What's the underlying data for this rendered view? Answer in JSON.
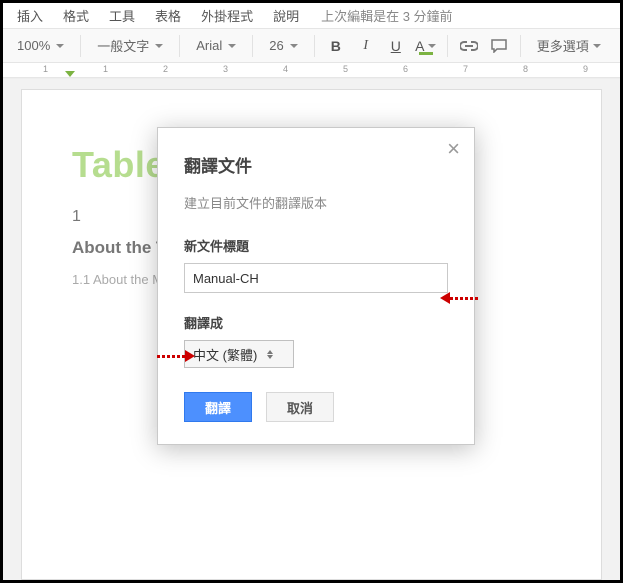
{
  "menubar": {
    "items": [
      "插入",
      "格式",
      "工具",
      "表格",
      "外掛程式",
      "說明"
    ],
    "last_edit": "上次編輯是在 3 分鐘前"
  },
  "toolbar": {
    "zoom": "100%",
    "style": "一般文字",
    "font": "Arial",
    "size": "26",
    "bold": "B",
    "italic": "I",
    "underline": "U",
    "textcolor": "A",
    "more": "更多選項"
  },
  "ruler": {
    "marks": [
      "1",
      "1",
      "2",
      "3",
      "4",
      "5",
      "6",
      "7",
      "8",
      "9"
    ]
  },
  "document": {
    "heading": "Table of content",
    "num": "1",
    "h1": "About the TeamViewer Management Console 4",
    "sub": "1.1 About the Management Console 4"
  },
  "dialog": {
    "title": "翻譯文件",
    "subtitle": "建立目前文件的翻譯版本",
    "label_title": "新文件標題",
    "input_value": "Manual-CH",
    "label_lang": "翻譯成",
    "lang_value": "中文 (繁體)",
    "btn_ok": "翻譯",
    "btn_cancel": "取消"
  }
}
